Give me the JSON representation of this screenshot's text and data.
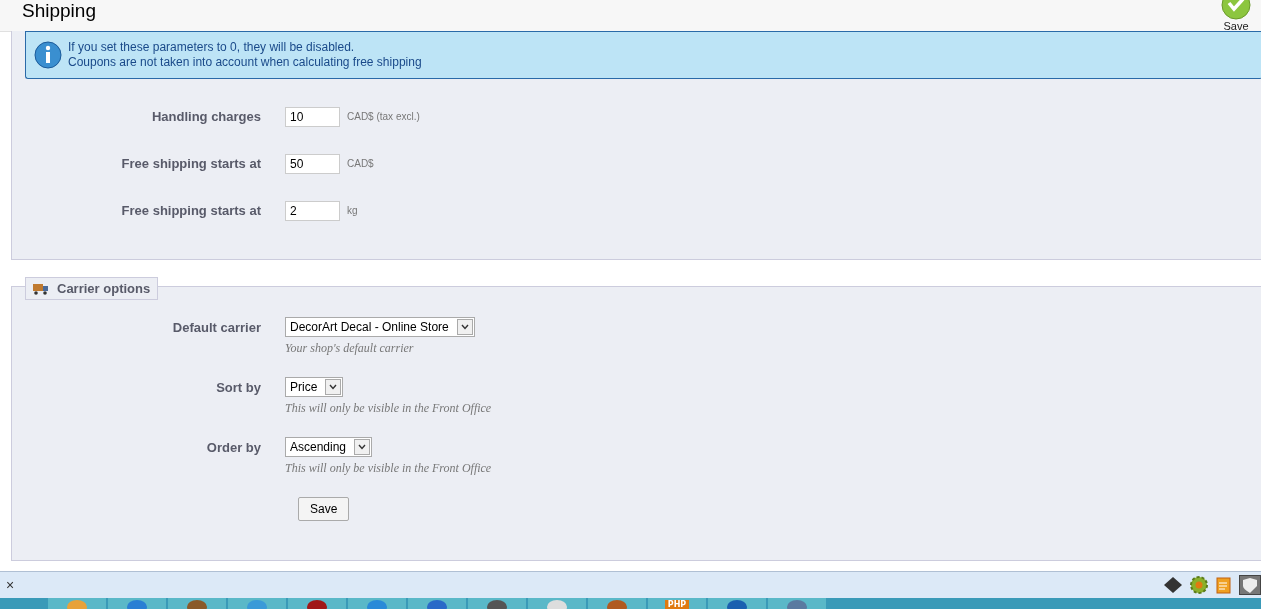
{
  "header": {
    "title": "Shipping",
    "save_label": "Save"
  },
  "info": {
    "lines": [
      "If you set these parameters to 0, they will be disabled.",
      "Coupons are not taken into account when calculating free shipping"
    ]
  },
  "fees": [
    {
      "label": "Handling charges",
      "value": "10",
      "unit": "CAD$ (tax excl.)"
    },
    {
      "label": "Free shipping starts at",
      "value": "50",
      "unit": "CAD$"
    },
    {
      "label": "Free shipping starts at",
      "value": "2",
      "unit": "kg"
    }
  ],
  "carrier_options": {
    "legend": "Carrier options",
    "fields": [
      {
        "label": "Default carrier",
        "value": "DecorArt Decal - Online Store",
        "hint": "Your shop's default carrier"
      },
      {
        "label": "Sort by",
        "value": "Price",
        "hint": "This will only be visible in the Front Office"
      },
      {
        "label": "Order by",
        "value": "Ascending",
        "hint": "This will only be visible in the Front Office"
      }
    ],
    "button": "Save"
  },
  "bottom_bar": {
    "close": "×"
  },
  "taskbar": {
    "items": [
      {
        "kind": "app",
        "color": "#e8a23a"
      },
      {
        "kind": "app",
        "color": "#2a7fd4"
      },
      {
        "kind": "app",
        "color": "#8a5a2a"
      },
      {
        "kind": "app",
        "color": "#3a9ad8"
      },
      {
        "kind": "app",
        "color": "#a01818"
      },
      {
        "kind": "app",
        "color": "#2a8ad8"
      },
      {
        "kind": "app",
        "color": "#2a6ac8"
      },
      {
        "kind": "app",
        "color": "#555555"
      },
      {
        "kind": "app",
        "color": "#dddddd"
      },
      {
        "kind": "app",
        "color": "#b05a20"
      },
      {
        "kind": "php",
        "label": "PHP",
        "color": "#e07a10"
      },
      {
        "kind": "app",
        "color": "#1a60b0"
      },
      {
        "kind": "app",
        "color": "#5a7aa0"
      }
    ]
  }
}
